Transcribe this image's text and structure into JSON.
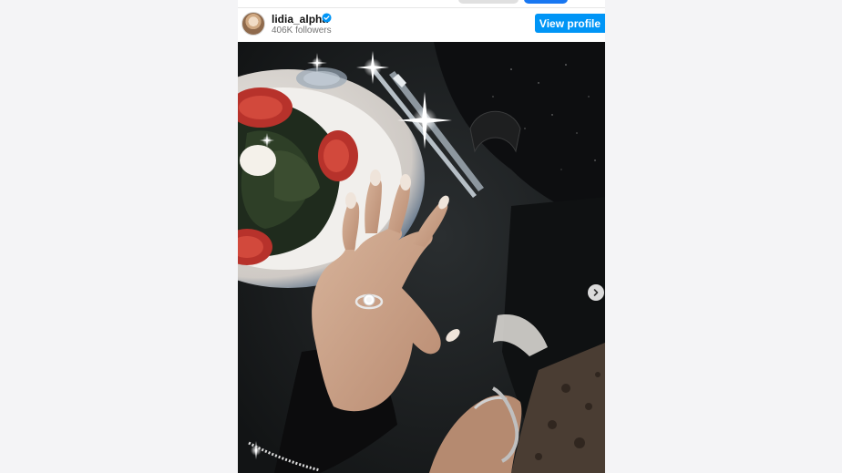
{
  "post": {
    "username": "lidia_alpha",
    "followers": "406K followers",
    "view_profile_label": "View profile",
    "verified": true
  },
  "icons": {
    "verified": "verified-badge-icon",
    "next": "chevron-right-icon",
    "avatar": "profile-avatar"
  },
  "colors": {
    "accent": "#0095f6",
    "verified": "#0095f6"
  }
}
